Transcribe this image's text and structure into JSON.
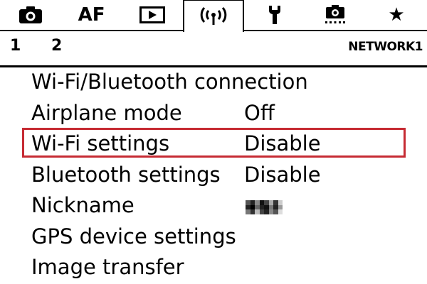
{
  "tabs": [
    {
      "name": "shooting-tab",
      "icon": "camera-icon",
      "label": ""
    },
    {
      "name": "af-tab",
      "icon": "",
      "label": "AF"
    },
    {
      "name": "playback-tab",
      "icon": "play-icon",
      "label": ""
    },
    {
      "name": "network-tab",
      "icon": "wireless-icon",
      "label": "",
      "active": true
    },
    {
      "name": "setup-tab",
      "icon": "wrench-icon",
      "label": ""
    },
    {
      "name": "custom-functions-tab",
      "icon": "custom-camera-icon",
      "label": ""
    },
    {
      "name": "my-menu-tab",
      "icon": "star-icon",
      "label": "★"
    }
  ],
  "subtabs": {
    "page1": "1",
    "page2": "2",
    "section_name": "NETWORK1"
  },
  "menu": {
    "items": [
      {
        "label": "Wi-Fi/Bluetooth connection",
        "value": ""
      },
      {
        "label": "Airplane mode",
        "value": "Off"
      },
      {
        "label": "Wi-Fi settings",
        "value": "Disable",
        "selected": true
      },
      {
        "label": "Bluetooth settings",
        "value": "Disable"
      },
      {
        "label": "Nickname",
        "value": ""
      },
      {
        "label": "GPS device settings",
        "value": ""
      },
      {
        "label": "Image transfer",
        "value": ""
      }
    ]
  },
  "colors": {
    "selection_border": "#c62b33",
    "text": "#000000",
    "background": "#ffffff"
  }
}
